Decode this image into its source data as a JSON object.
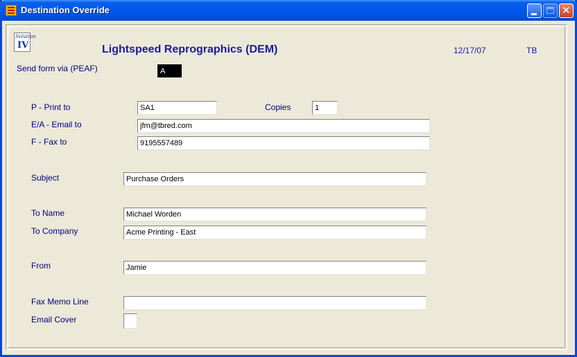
{
  "window": {
    "title": "Destination Override"
  },
  "header": {
    "logo_text": "Solution",
    "logo_numeral": "IV",
    "company": "Lightspeed Reprographics (DEM)",
    "date": "12/17/07",
    "user": "TB"
  },
  "form": {
    "send_via_label": "Send form via (PEAF)",
    "send_via_value": "A",
    "print_label": "P - Print to",
    "print_value": "SA1",
    "copies_label": "Copies",
    "copies_value": "1",
    "email_label": "E/A - Email to",
    "email_value": "jfm@tbred.com",
    "fax_label": "F - Fax to",
    "fax_value": "9195557489",
    "subject_label": "Subject",
    "subject_value": "Purchase Orders",
    "to_name_label": "To Name",
    "to_name_value": "Michael Worden",
    "to_company_label": "To Company",
    "to_company_value": "Acme Printing - East",
    "from_label": "From",
    "from_value": "Jamie",
    "fax_memo_label": "Fax Memo Line",
    "fax_memo_value": "",
    "email_cover_label": "Email Cover",
    "email_cover_value": ""
  },
  "colors": {
    "titlebar": "#0055e5",
    "label_text": "#000080",
    "window_bg": "#ece9d8"
  }
}
